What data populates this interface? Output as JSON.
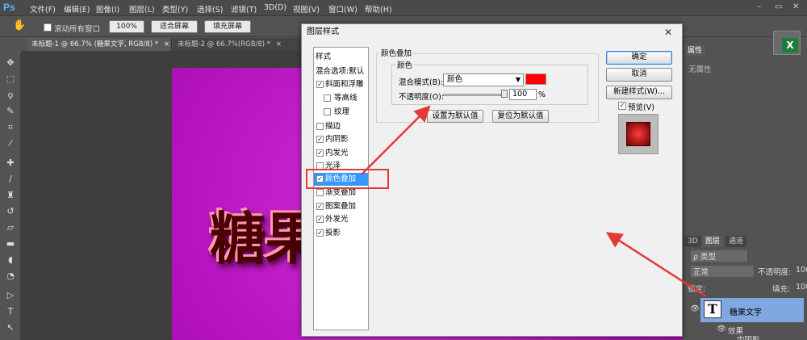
{
  "app": {
    "logo": "Ps"
  },
  "menu": [
    "文件(F)",
    "编辑(E)",
    "图像(I)",
    "图层(L)",
    "类型(Y)",
    "选择(S)",
    "滤镜(T)",
    "3D(D)",
    "视图(V)",
    "窗口(W)",
    "帮助(H)"
  ],
  "window_controls": {
    "minimize": "–",
    "restore": "▭",
    "close": "✕"
  },
  "options": {
    "scroll_all_label": "滚动所有窗口",
    "zoom_100": "100%",
    "fit_screen": "适合屏幕",
    "fill_screen": "填充屏幕"
  },
  "tabs": [
    "未标题-1 @ 66.7% (糖果文字, RGB/8) *",
    "未标题-2 @ 66.7%(RGB/8) *"
  ],
  "tab_close": "×",
  "canvas": {
    "text": "糖果"
  },
  "right_panel": {
    "properties_title": "属性",
    "no_properties": "无属性",
    "panel_tabs": [
      "3D",
      "图层",
      "通道"
    ],
    "kind_filter": "ρ 类型",
    "blend_mode": "正常",
    "opacity_label": "不透明度:",
    "opacity_value": "100",
    "lock_label": "锁定:",
    "fill_label": "填充:",
    "fill_value": "100",
    "layer_name": "糖果文字",
    "effects_label": "效果",
    "inner_shadow_label": "内阴影"
  },
  "dialog": {
    "title": "图层样式",
    "close": "✕",
    "styles_header": "样式",
    "blend_options": "混合选项:默认",
    "items": [
      {
        "label": "斜面和浮雕",
        "checked": true
      },
      {
        "label": "等高线",
        "checked": false,
        "indent": true
      },
      {
        "label": "纹理",
        "checked": false,
        "indent": true
      },
      {
        "label": "描边",
        "checked": false
      },
      {
        "label": "内阴影",
        "checked": true
      },
      {
        "label": "内发光",
        "checked": true
      },
      {
        "label": "光泽",
        "checked": false
      },
      {
        "label": "颜色叠加",
        "checked": true,
        "selected": true
      },
      {
        "label": "渐变叠加",
        "checked": false
      },
      {
        "label": "图案叠加",
        "checked": true
      },
      {
        "label": "外发光",
        "checked": true
      },
      {
        "label": "投影",
        "checked": true
      }
    ],
    "section_title": "颜色叠加",
    "sub_title": "颜色",
    "blend_mode_label": "混合模式(B):",
    "blend_mode_value": "颜色",
    "overlay_color": "#ff0000",
    "opacity_label": "不透明度(O):",
    "opacity_value": "100",
    "opacity_percent": 100,
    "percent_sign": "%",
    "set_default": "设置为默认值",
    "reset_default": "复位为默认值",
    "ok": "确定",
    "cancel": "取消",
    "new_style": "新建样式(W)...",
    "preview_label": "预览(V)",
    "preview_checked": "✓"
  },
  "annotation_color": "#e53935"
}
